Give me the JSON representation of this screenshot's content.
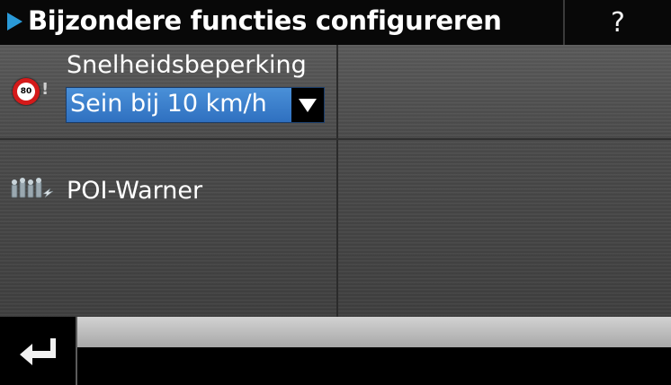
{
  "titlebar": {
    "title": "Bijzondere functies configureren",
    "help_label": "?",
    "accent_color": "#2a9ad8"
  },
  "settings": {
    "speed_limit": {
      "label": "Snelheidsbeperking",
      "icon_text": "80",
      "icon_name": "speed-limit-sign-icon",
      "selected_option": "Sein bij 10 km/h",
      "dropdown_icon": "chevron-down-icon"
    },
    "poi_warner": {
      "label": "POI-Warner",
      "icon_name": "poi-warner-icon"
    }
  },
  "bottombar": {
    "back_icon": "return-arrow-icon"
  }
}
